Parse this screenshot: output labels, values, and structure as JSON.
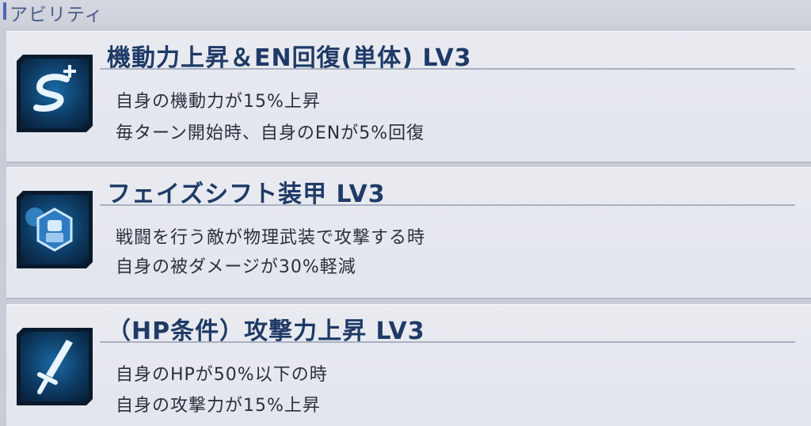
{
  "section": {
    "title": "アビリティ"
  },
  "abilities": [
    {
      "icon": "mobility-up-icon",
      "title": "機動力上昇＆EN回復(単体) LV3",
      "lines": [
        "自身の機動力が15%上昇",
        "毎ターン開始時、自身のENが5%回復"
      ]
    },
    {
      "icon": "phase-shift-armor-icon",
      "title": "フェイズシフト装甲 LV3",
      "lines": [
        "戦闘を行う敵が物理武装で攻撃する時",
        "自身の被ダメージが30%軽減"
      ]
    },
    {
      "icon": "sword-icon",
      "title": "（HP条件）攻撃力上昇 LV3",
      "lines": [
        "自身のHPが50%以下の時",
        "自身の攻撃力が15%上昇"
      ]
    }
  ],
  "colors": {
    "accent": "#4f66b8",
    "title": "#1f3a66",
    "icon_bg": "#0d3b63"
  }
}
